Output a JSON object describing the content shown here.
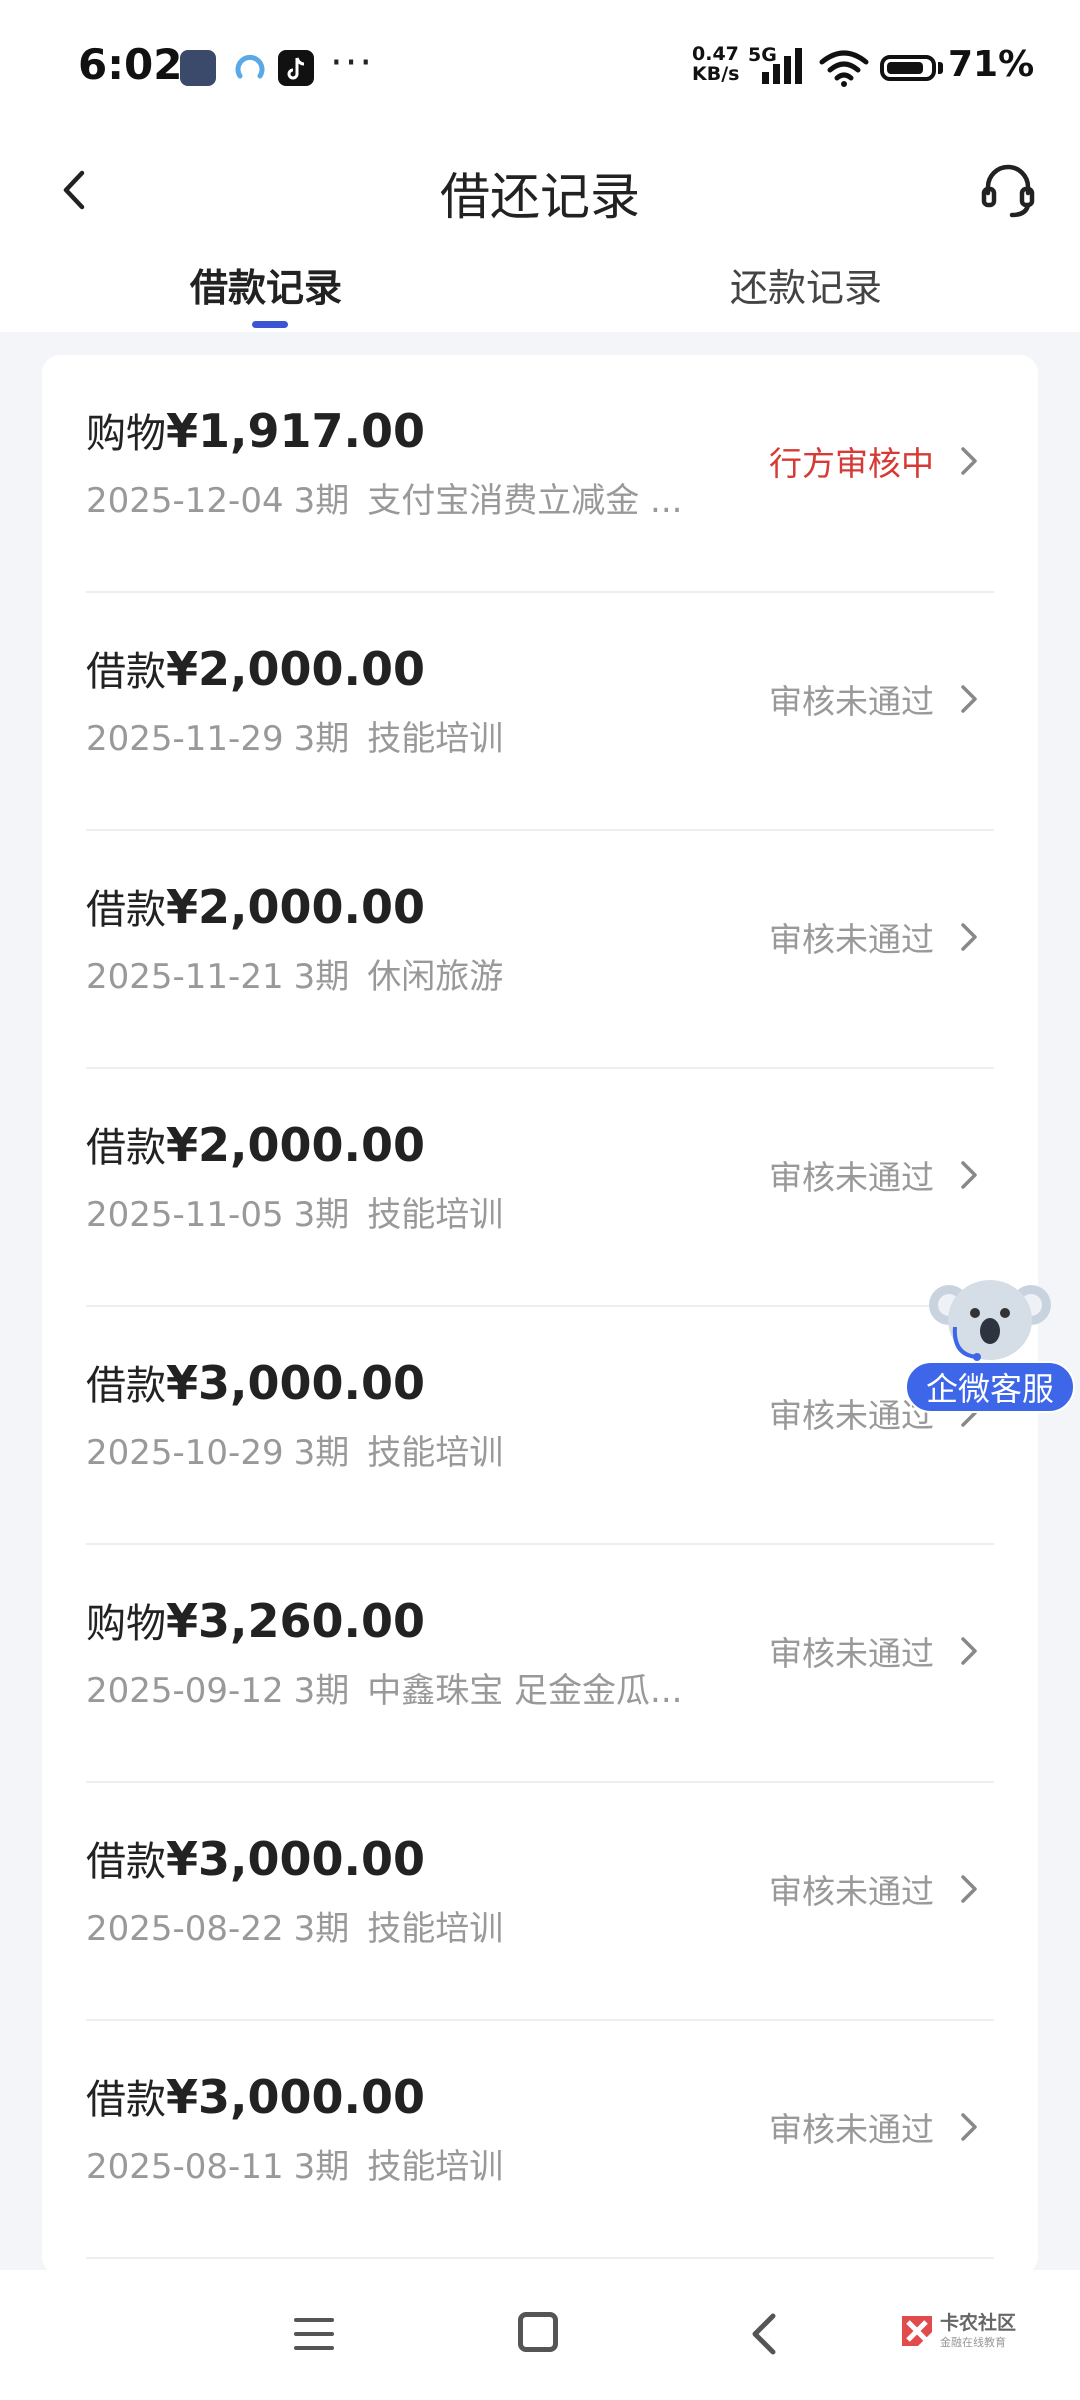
{
  "status_bar": {
    "time": "6:02",
    "net_speed_value": "0.47",
    "net_speed_unit": "KB/s",
    "network": "5G",
    "battery": "71%",
    "more": "···"
  },
  "header": {
    "title": "借还记录"
  },
  "tabs": [
    {
      "label": "借款记录",
      "active": true
    },
    {
      "label": "还款记录",
      "active": false
    }
  ],
  "records": [
    {
      "type": "购物",
      "amount": "¥1,917.00",
      "date": "2025-12-04",
      "term": "3期",
      "desc": "支付宝消费立减金 ...",
      "status": "行方审核中",
      "pending": true
    },
    {
      "type": "借款",
      "amount": "¥2,000.00",
      "date": "2025-11-29",
      "term": "3期",
      "desc": "技能培训",
      "status": "审核未通过",
      "pending": false
    },
    {
      "type": "借款",
      "amount": "¥2,000.00",
      "date": "2025-11-21",
      "term": "3期",
      "desc": "休闲旅游",
      "status": "审核未通过",
      "pending": false
    },
    {
      "type": "借款",
      "amount": "¥2,000.00",
      "date": "2025-11-05",
      "term": "3期",
      "desc": "技能培训",
      "status": "审核未通过",
      "pending": false
    },
    {
      "type": "借款",
      "amount": "¥3,000.00",
      "date": "2025-10-29",
      "term": "3期",
      "desc": "技能培训",
      "status": "审核未通过",
      "pending": false
    },
    {
      "type": "购物",
      "amount": "¥3,260.00",
      "date": "2025-09-12",
      "term": "3期",
      "desc": "中鑫珠宝 足金金瓜...",
      "status": "审核未通过",
      "pending": false
    },
    {
      "type": "借款",
      "amount": "¥3,000.00",
      "date": "2025-08-22",
      "term": "3期",
      "desc": "技能培训",
      "status": "审核未通过",
      "pending": false
    },
    {
      "type": "借款",
      "amount": "¥3,000.00",
      "date": "2025-08-11",
      "term": "3期",
      "desc": "技能培训",
      "status": "审核未通过",
      "pending": false
    }
  ],
  "floating_service": {
    "label": "企微客服"
  },
  "watermark": {
    "name": "卡农社区",
    "slogan": "金融在线教育"
  },
  "colors": {
    "accent": "#3a56d4",
    "pending_status": "#d63a35",
    "muted": "#999999"
  },
  "icons": [
    "back-arrow-icon",
    "headset-icon",
    "chevron-right-icon",
    "menu-icon",
    "home-icon",
    "back-icon"
  ]
}
